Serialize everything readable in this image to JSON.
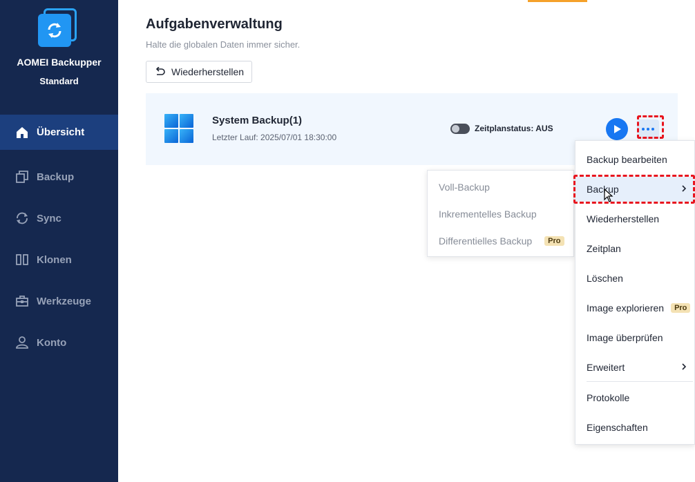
{
  "app": {
    "name_line1": "AOMEI Backupper",
    "name_line2": "Standard"
  },
  "sidebar": {
    "items": [
      {
        "label": "Übersicht",
        "icon": "home-icon",
        "active": true
      },
      {
        "label": "Backup",
        "icon": "copy-icon",
        "active": false
      },
      {
        "label": "Sync",
        "icon": "sync-icon",
        "active": false
      },
      {
        "label": "Klonen",
        "icon": "clone-icon",
        "active": false
      },
      {
        "label": "Werkzeuge",
        "icon": "toolbox-icon",
        "active": false
      },
      {
        "label": "Konto",
        "icon": "user-icon",
        "active": false
      }
    ]
  },
  "main": {
    "title": "Aufgabenverwaltung",
    "subtitle": "Halte die globalen Daten immer sicher.",
    "restore_label": "Wiederherstellen"
  },
  "task": {
    "name": "System Backup(1)",
    "last_run": "Letzter Lauf: 2025/07/01 18:30:00",
    "schedule_status": "Zeitplanstatus: AUS",
    "schedule_on": false
  },
  "context_menu": {
    "items": [
      {
        "label": "Backup bearbeiten"
      },
      {
        "label": "Backup",
        "submenu": true
      },
      {
        "label": "Wiederherstellen"
      },
      {
        "label": "Zeitplan"
      },
      {
        "label": "Löschen"
      },
      {
        "label": "Image explorieren",
        "badge": "Pro"
      },
      {
        "label": "Image überprüfen"
      },
      {
        "label": "Erweitert",
        "submenu": true
      },
      {
        "label": "Protokolle"
      },
      {
        "label": "Eigenschaften"
      }
    ]
  },
  "submenu": {
    "items": [
      {
        "label": "Voll-Backup"
      },
      {
        "label": "Inkrementelles Backup"
      },
      {
        "label": "Differentielles Backup",
        "badge": "Pro"
      }
    ]
  },
  "colors": {
    "sidebar_bg": "#15284f",
    "sidebar_active": "#1c3f7e",
    "accent": "#1877f2",
    "highlight": "#e8151f"
  }
}
